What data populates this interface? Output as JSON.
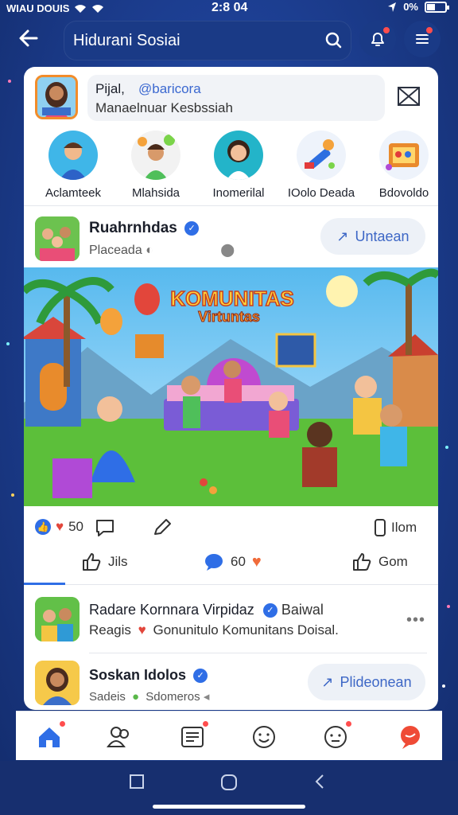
{
  "status_bar": {
    "carrier": "WIAU DOUIS",
    "time": "2:8 04",
    "battery": "0%"
  },
  "header": {
    "title": "Hidurani Sosiai"
  },
  "profile": {
    "name": "Pijal,",
    "handle": "@baricora",
    "subtitle": "Manaelnuar Kesbssiah"
  },
  "stories": [
    {
      "label": "Aclamteek"
    },
    {
      "label": "Mlahsida"
    },
    {
      "label": "Inomerilal"
    },
    {
      "label": "IOolo Deada"
    },
    {
      "label": "Bdovoldo"
    }
  ],
  "post": {
    "author": "Ruahrnhdas",
    "subtitle": "Placeada",
    "follow_label": "Untaean",
    "image_title_line1": "KOMUNITAS",
    "image_title_line2": "Virtuntas",
    "stats": {
      "likes": "50",
      "views": "Ilom"
    },
    "actions": {
      "like_label": "Jils",
      "comment_count": "60",
      "share_label": "Gom"
    }
  },
  "comments": [
    {
      "title": "Radare Kornnara Virpidaz",
      "handle": "Baiwal",
      "text": "Reagis",
      "text2": "Gonunitulo Komunitans Doisal."
    },
    {
      "title": "Soskan Idolos",
      "sub1": "Sadeis",
      "sub2": "Sdomeros",
      "follow_label": "Plideonean"
    }
  ],
  "colors": {
    "background": "#1f3f95",
    "accent": "#2f6ee6",
    "badge": "#ff4d4d",
    "nav_active": "#2f6ee6"
  },
  "icons": {
    "back": "arrow-left-icon",
    "search": "search-icon",
    "notifications": "bell-icon",
    "menu": "menu-icon",
    "mail": "mail-icon",
    "nav": [
      "home-icon",
      "friends-icon",
      "feed-icon",
      "smiley-icon",
      "emoji-icon",
      "chat-icon"
    ]
  }
}
